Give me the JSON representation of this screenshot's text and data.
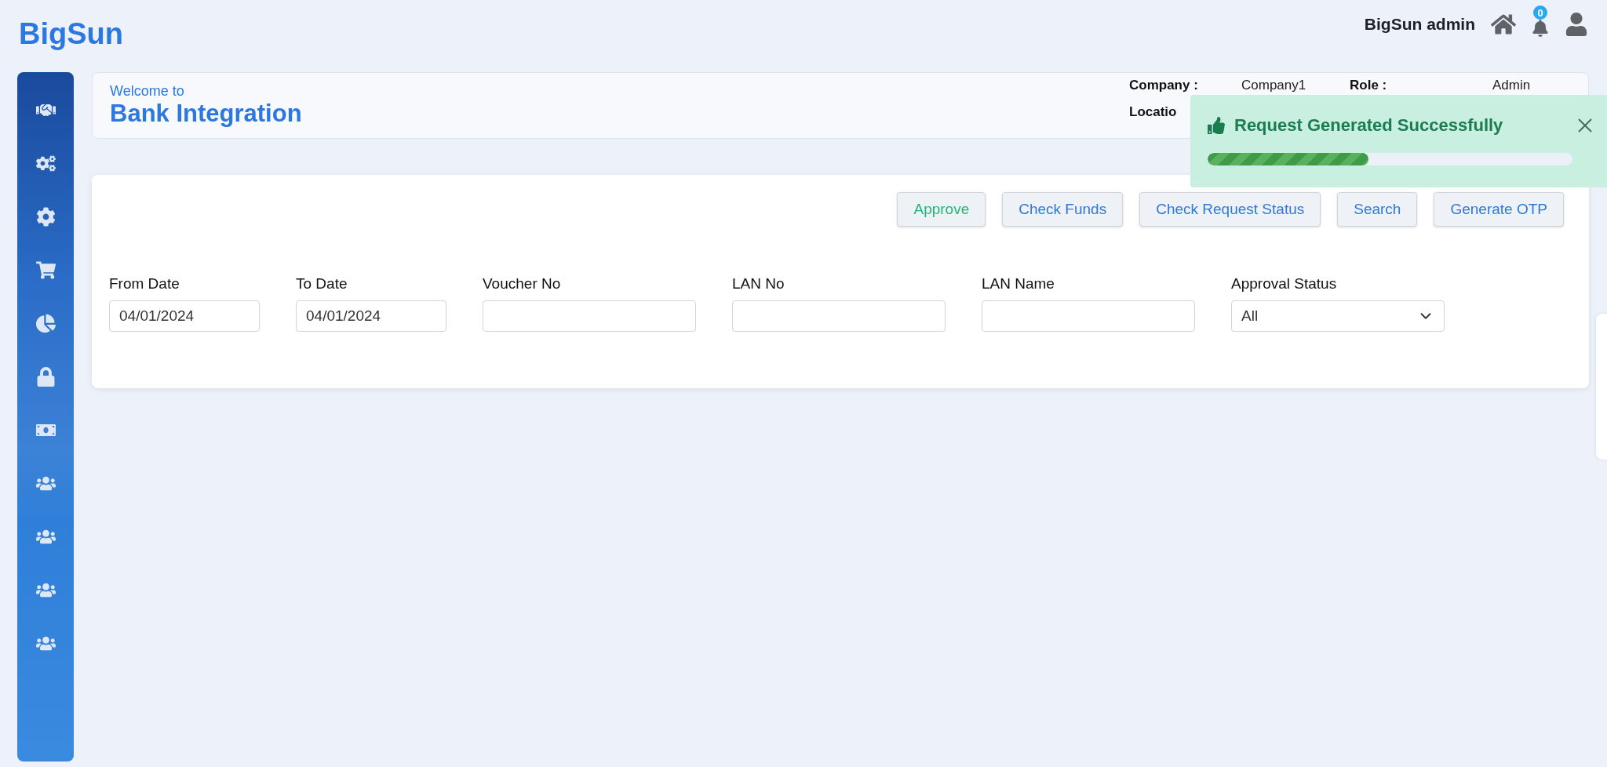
{
  "logo": "BigSun",
  "user": {
    "name": "BigSun admin",
    "notifications": "0"
  },
  "sidebar": {
    "items": [
      {
        "kind": "handshake"
      },
      {
        "kind": "cogs"
      },
      {
        "kind": "cog"
      },
      {
        "kind": "cart"
      },
      {
        "kind": "pie"
      },
      {
        "kind": "lock"
      },
      {
        "kind": "money"
      },
      {
        "kind": "users"
      },
      {
        "kind": "users"
      },
      {
        "kind": "users"
      },
      {
        "kind": "users"
      }
    ]
  },
  "header": {
    "welcome": "Welcome to",
    "title": "Bank Integration",
    "info": [
      {
        "label": "Company :",
        "value": "Company1"
      },
      {
        "label": "Role :",
        "value": "Admin"
      },
      {
        "label": "Locatio"
      }
    ]
  },
  "toast": {
    "message": "Request Generated Successfully",
    "level": 0.44
  },
  "actions": [
    {
      "label": "Approve",
      "kind": "success"
    },
    {
      "label": "Check Funds",
      "kind": "primary"
    },
    {
      "label": "Check Request Status",
      "kind": "primary"
    },
    {
      "label": "Search",
      "kind": "primary"
    },
    {
      "label": "Generate OTP",
      "kind": "primary"
    }
  ],
  "filters": [
    {
      "label": "From Date",
      "kind": "date",
      "value": "04/01/2024"
    },
    {
      "label": "To Date",
      "kind": "date",
      "value": "04/01/2024"
    },
    {
      "label": "Voucher No",
      "kind": "text"
    },
    {
      "label": "LAN No",
      "kind": "text"
    },
    {
      "label": "LAN Name",
      "kind": "text"
    },
    {
      "label": "Approval Status",
      "kind": "select",
      "value": "All"
    }
  ]
}
